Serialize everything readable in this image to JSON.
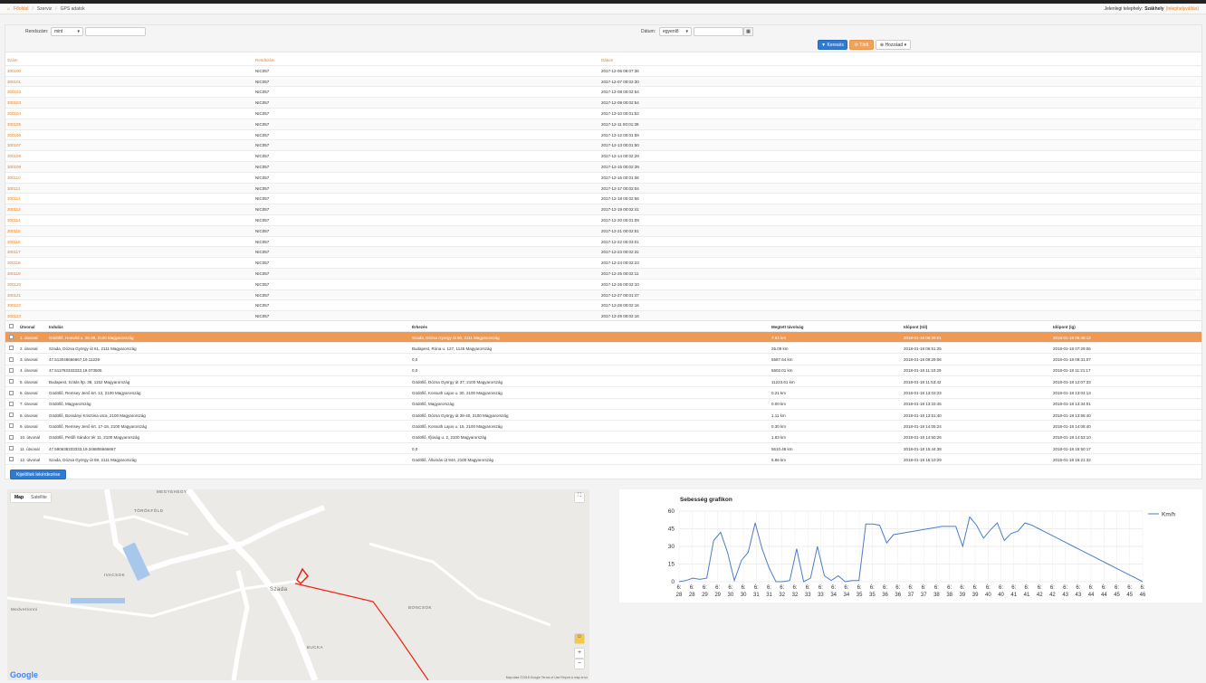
{
  "breadcrumb": {
    "home": "Főoldal",
    "items": [
      "Szerviz",
      "GPS adatok"
    ]
  },
  "site": {
    "label": "Jelenlegi telephely:",
    "name": "Szákhely",
    "change": "(telephelyváltás)"
  },
  "filters": {
    "rendszam_label": "Rendszám:",
    "rendszam_mode": "mint",
    "rendszam_value": "",
    "datum_label": "Dátum:",
    "datum_mode": "egyenlő",
    "datum_value": ""
  },
  "buttons": {
    "search": "Keresés",
    "reset": "Törli",
    "add": "Hozzáad"
  },
  "table1": {
    "headers": [
      "Szám",
      "Rendszám",
      "Dátum"
    ],
    "rows": [
      [
        "300100",
        "NIC057",
        "2017-12-06 06:07:36"
      ],
      [
        "300101",
        "NIC057",
        "2017-12-07 00:02:30"
      ],
      [
        "300102",
        "NIC057",
        "2017-12-08 00:02:54"
      ],
      [
        "300103",
        "NIC057",
        "2017-12-09 00:02:54"
      ],
      [
        "300104",
        "NIC057",
        "2017-12-10 00:01:52"
      ],
      [
        "300105",
        "NIC057",
        "2017-12-11 00:01:38"
      ],
      [
        "300106",
        "NIC057",
        "2017-12-12 00:01:59"
      ],
      [
        "300107",
        "NIC057",
        "2017-12-13 00:01:50"
      ],
      [
        "300108",
        "NIC057",
        "2017-12-14 00:02:29"
      ],
      [
        "300109",
        "NIC057",
        "2017-12-15 00:02:39"
      ],
      [
        "300110",
        "NIC057",
        "2017-12-16 00:01:06"
      ],
      [
        "300111",
        "NIC057",
        "2017-12-17 00:02:04"
      ],
      [
        "300112",
        "NIC057",
        "2017-12-18 00:02:56"
      ],
      [
        "300113",
        "NIC057",
        "2017-12-19 00:02:41"
      ],
      [
        "300114",
        "NIC057",
        "2017-12-20 00:01:09"
      ],
      [
        "300115",
        "NIC057",
        "2017-12-21 00:02:51"
      ],
      [
        "300116",
        "NIC057",
        "2017-12-22 00:03:01"
      ],
      [
        "300117",
        "NIC057",
        "2017-12-23 00:02:31"
      ],
      [
        "300118",
        "NIC057",
        "2017-12-24 00:02:23"
      ],
      [
        "300119",
        "NIC057",
        "2017-12-25 00:02:11"
      ],
      [
        "300120",
        "NIC057",
        "2017-12-26 00:02:10"
      ],
      [
        "300121",
        "NIC057",
        "2017-12-27 00:01:47"
      ],
      [
        "300122",
        "NIC057",
        "2017-12-28 00:02:16"
      ],
      [
        "300123",
        "NIC057",
        "2017-12-29 00:02:16"
      ]
    ]
  },
  "table2": {
    "headers": [
      "Útvonal",
      "Indulás",
      "Érkezés",
      "Megtett távolság",
      "Időpont (tól)",
      "Időpont (ig)"
    ],
    "rows": [
      [
        "1. útvonal",
        "Gödöllő, Honvéd u. 26-28, 2100 Magyarország",
        "Szada, Dózsa György út 80, 2111 Magyarország",
        "7.84 km",
        "2018-01-18 06:29:01",
        "2018-01-18 06:45:12"
      ],
      [
        "2. útvonal",
        "Szada, Dózsa György út 61, 2111 Magyarország",
        "Budapest, Róna u. 127, 1145 Magyarország",
        "25.09 km",
        "2018-01-18 06:51:25",
        "2018-01-18 07:29:06"
      ],
      [
        "3. útvonal",
        "47.513048666667,19.11229",
        "0,0",
        "5587.64 km",
        "2018-01-18 09:29:06",
        "2018-01-18 09:31:07"
      ],
      [
        "4. útvonal",
        "47.511793333333,19.073505",
        "0,0",
        "5602.01 km",
        "2018-01-18 11:10:29",
        "2018-01-18 11:21:17"
      ],
      [
        "5. útvonal",
        "Budapest, Szitás ltp. 38, 1152 Magyarország",
        "Gödöllő, Dózsa György út 37, 2100 Magyarország",
        "11223.61 km",
        "2018-01-18 11:53:42",
        "2018-01-18 12:07:33"
      ],
      [
        "6. útvonal",
        "Gödöllő, Remsey Jenő krt. 12, 2100 Magyarország",
        "Gödöllő, Kossuth Lajos u. 30, 2100 Magyarország",
        "0.21 km",
        "2018-01-18 13:03:23",
        "2018-01-18 13:04:13"
      ],
      [
        "7. útvonal",
        "Gödöllő, Magyarország",
        "Gödöllő, Magyarország",
        "0.00 km",
        "2018-01-18 13:33:45",
        "2018-01-18 13:34:01"
      ],
      [
        "8. útvonal",
        "Gödöllő, Bossányi Krisztina utca, 2100 Magyarország",
        "Gödöllő, Dózsa György út 38-40, 2100 Magyarország",
        "1.11 km",
        "2018-01-18 13:51:40",
        "2018-01-18 13:55:40"
      ],
      [
        "9. útvonal",
        "Gödöllő, Remsey Jenő krt. 17-18, 2100 Magyarország",
        "Gödöllő, Kossuth Lajos u. 15, 2100 Magyarország",
        "0.30 km",
        "2018-01-18 14:05:24",
        "2018-01-18 14:08:40"
      ],
      [
        "10. útvonal",
        "Gödöllő, Petőfi Sándor tér 11, 2100 Magyarország",
        "Gödöllő, Ifjúság u. 2, 2100 Magyarország",
        "1.83 km",
        "2018-01-18 14:50:26",
        "2018-01-18 14:53:10"
      ],
      [
        "11. útvonal",
        "47.590638333333,19.346806666667",
        "0,0",
        "5610.48 km",
        "2018-01-18 15:44:38",
        "2018-01-18 15:50:17"
      ],
      [
        "12. útvonal",
        "Szada, Dózsa György út 59, 2111 Magyarország",
        "Gödöllő, Állomás út 944, 2100 Magyarország",
        "6.86 km",
        "2018-01-18 16:10:29",
        "2018-01-18 16:21:32"
      ]
    ],
    "selected_index": 0,
    "report_button": "Kijelöltek lekérdezése"
  },
  "map": {
    "tabs": [
      "Map",
      "Satellite"
    ],
    "places": [
      "MEGYEHEGY",
      "TÖRÖKFÖLD",
      "IVACSOK",
      "Szada",
      "BONCSOK",
      "BUCKA",
      "Medvetlonni"
    ],
    "footer": "Map data ©2018 Google   Terms of Use   Report a map error",
    "logo": "Google",
    "zoom_in": "+",
    "zoom_out": "−"
  },
  "chart_data": {
    "type": "line",
    "title": "Sebesség grafikon",
    "ylim": [
      0,
      60
    ],
    "yticks": [
      0,
      15,
      30,
      45,
      60
    ],
    "grid": true,
    "legend": "right",
    "series": [
      {
        "name": "Km/h",
        "color": "#4a7ec9",
        "values": [
          0,
          1,
          3,
          2,
          3,
          35,
          42,
          25,
          1,
          18,
          25,
          50,
          28,
          12,
          0,
          0,
          1,
          28,
          0,
          3,
          30,
          5,
          1,
          5,
          0,
          1,
          1,
          49,
          49,
          48,
          33,
          40,
          41,
          42,
          43,
          44,
          45,
          46,
          47,
          47,
          47,
          30,
          55,
          48,
          37,
          44,
          50,
          35,
          41,
          43,
          50,
          48,
          45,
          42,
          39,
          36,
          33,
          30,
          27,
          24,
          21,
          18,
          15,
          12,
          9,
          6,
          3,
          0
        ]
      }
    ],
    "x_top": [
      "6:",
      "6:",
      "6:",
      "6:",
      "6:",
      "6:",
      "6:",
      "6:",
      "6:",
      "6:",
      "6:",
      "6:",
      "6:",
      "6:",
      "6:",
      "6:",
      "6:",
      "6:",
      "6:",
      "6:",
      "6:",
      "6:",
      "6:",
      "6:",
      "6:",
      "6:",
      "6:",
      "6:",
      "6:",
      "6:",
      "6:",
      "6:",
      "6:",
      "6:",
      "6:",
      "6:",
      "6:"
    ],
    "x_bottom": [
      "28",
      "28",
      "29",
      "29",
      "30",
      "30",
      "31",
      "31",
      "32",
      "32",
      "33",
      "33",
      "34",
      "34",
      "35",
      "35",
      "36",
      "36",
      "37",
      "37",
      "38",
      "38",
      "39",
      "39",
      "40",
      "40",
      "41",
      "41",
      "42",
      "42",
      "43",
      "43",
      "44",
      "44",
      "45",
      "45",
      "46"
    ]
  }
}
